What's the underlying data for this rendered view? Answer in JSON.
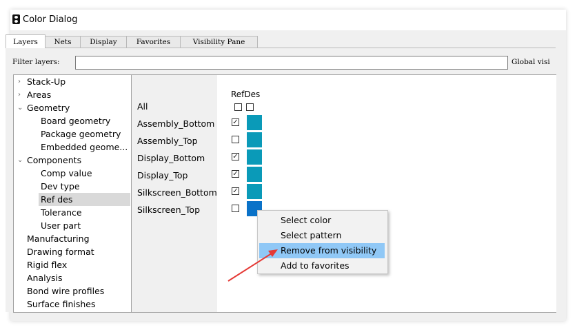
{
  "window": {
    "title": "Color Dialog"
  },
  "tabs": [
    "Layers",
    "Nets",
    "Display",
    "Favorites",
    "Visibility Pane"
  ],
  "filter": {
    "label": "Filter layers:",
    "value": "",
    "global_label": "Global visi"
  },
  "tree": [
    {
      "label": "Stack-Up",
      "expander": "›"
    },
    {
      "label": "Areas",
      "expander": "›"
    },
    {
      "label": "Geometry",
      "expander": "⌄"
    },
    {
      "label": "Board geometry"
    },
    {
      "label": "Package geometry"
    },
    {
      "label": "Embedded geome..."
    },
    {
      "label": "Components",
      "expander": "⌄"
    },
    {
      "label": "Comp value"
    },
    {
      "label": "Dev type"
    },
    {
      "label": "Ref des",
      "selected": true
    },
    {
      "label": "Tolerance"
    },
    {
      "label": "User part"
    },
    {
      "label": "Manufacturing"
    },
    {
      "label": "Drawing format"
    },
    {
      "label": "Rigid flex"
    },
    {
      "label": "Analysis"
    },
    {
      "label": "Bond wire profiles"
    },
    {
      "label": "Surface finishes"
    }
  ],
  "grid": {
    "column_header": "RefDes",
    "rows": [
      {
        "label": "All",
        "checked": false
      },
      {
        "label": "Assembly_Bottom",
        "checked": true,
        "color": "#0a9ab8"
      },
      {
        "label": "Assembly_Top",
        "checked": false,
        "color": "#0a9ab8"
      },
      {
        "label": "Display_Bottom",
        "checked": true,
        "color": "#0a9ab8"
      },
      {
        "label": "Display_Top",
        "checked": true,
        "color": "#0a9ab8"
      },
      {
        "label": "Silkscreen_Bottom",
        "checked": true,
        "color": "#0a9ab8"
      },
      {
        "label": "Silkscreen_Top",
        "checked": false,
        "color": "#0a72c8"
      }
    ]
  },
  "context_menu": {
    "items": [
      {
        "label": "Select color"
      },
      {
        "label": "Select pattern"
      },
      {
        "label": "Remove from visibility",
        "highlighted": true
      },
      {
        "label": "Add to favorites"
      }
    ]
  },
  "annotation": {
    "arrow_color": "#e53935"
  }
}
